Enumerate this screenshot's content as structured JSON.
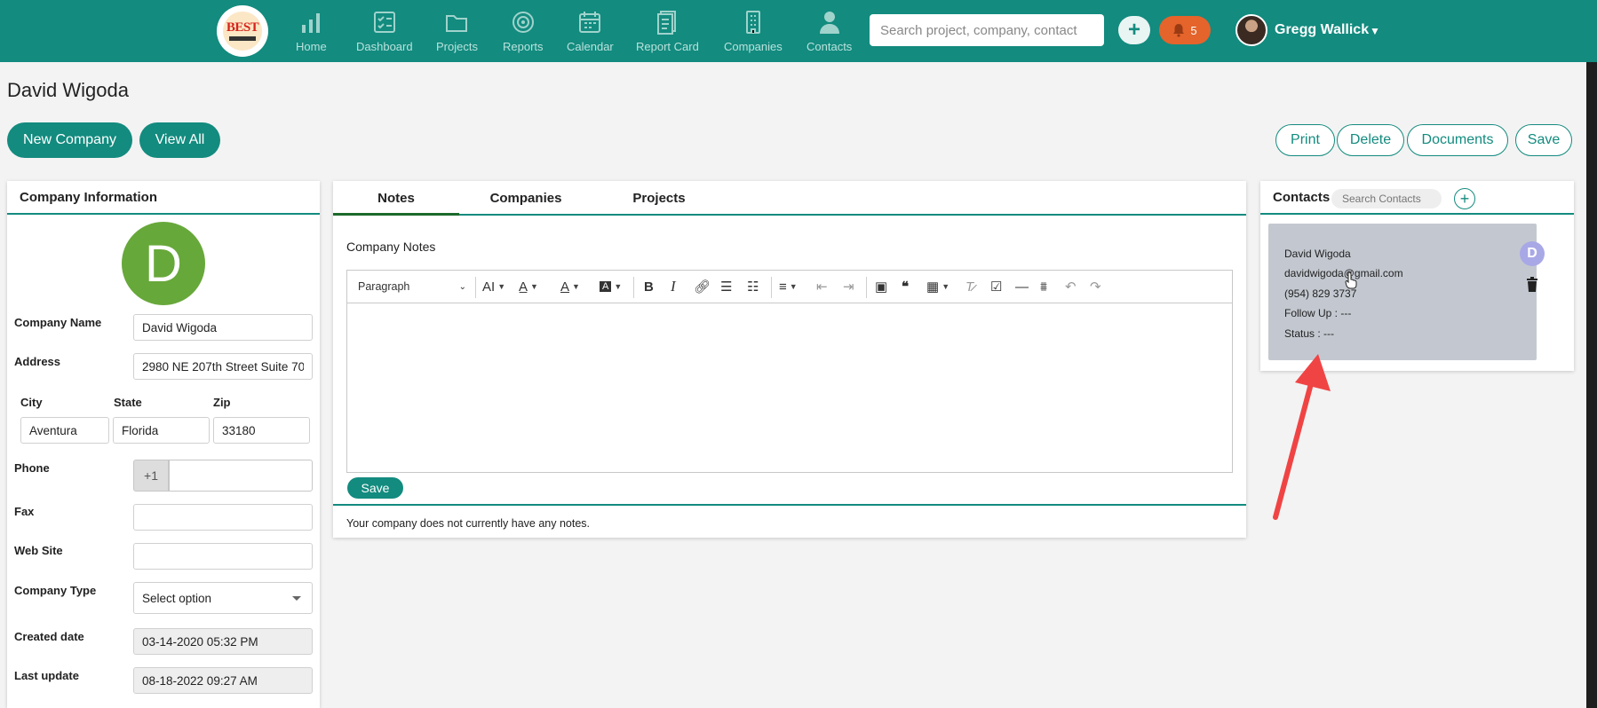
{
  "nav": {
    "items": [
      {
        "label": "Home",
        "icon": "bar-chart-icon"
      },
      {
        "label": "Dashboard",
        "icon": "dashboard-icon"
      },
      {
        "label": "Projects",
        "icon": "folder-icon"
      },
      {
        "label": "Reports",
        "icon": "target-icon"
      },
      {
        "label": "Calendar",
        "icon": "calendar-icon"
      },
      {
        "label": "Report Card",
        "icon": "report-card-icon"
      },
      {
        "label": "Companies",
        "icon": "building-icon"
      },
      {
        "label": "Contacts",
        "icon": "person-icon"
      }
    ],
    "search_placeholder": "Search project, company, contact",
    "notification_count": "5",
    "user_name": "Gregg Wallick",
    "logo_text": "BEST"
  },
  "page": {
    "title": "David Wigoda",
    "new_company_label": "New Company",
    "view_all_label": "View All",
    "print_label": "Print",
    "delete_label": "Delete",
    "documents_label": "Documents",
    "save_label": "Save"
  },
  "company_info": {
    "heading": "Company Information",
    "avatar_letter": "D",
    "company_name_label": "Company Name",
    "company_name": "David Wigoda",
    "address_label": "Address",
    "address": "2980 NE 207th Street Suite 70",
    "city_label": "City",
    "city": "Aventura",
    "state_label": "State",
    "state": "Florida",
    "zip_label": "Zip",
    "zip": "33180",
    "phone_label": "Phone",
    "phone_prefix": "+1",
    "phone": "",
    "fax_label": "Fax",
    "fax": "",
    "website_label": "Web Site",
    "website": "",
    "company_type_label": "Company Type",
    "company_type": "Select option",
    "created_label": "Created date",
    "created": "03-14-2020 05:32 PM",
    "updated_label": "Last update",
    "updated": "08-18-2022 09:27 AM"
  },
  "notes": {
    "tabs": [
      "Notes",
      "Companies",
      "Projects"
    ],
    "section_title": "Company Notes",
    "paragraph_label": "Paragraph",
    "save_label": "Save",
    "empty_message": "Your company does not currently have any notes."
  },
  "contacts": {
    "heading": "Contacts",
    "search_placeholder": "Search Contacts",
    "card": {
      "avatar_letter": "D",
      "name": "David Wigoda",
      "email": "davidwigoda@gmail.com",
      "phone": "(954) 829 3737",
      "follow_up": "Follow Up : ---",
      "status": "Status : ---"
    }
  },
  "colors": {
    "brand": "#138b7f",
    "notification": "#e4642b",
    "avatar_green": "#67a83a",
    "annotation_arrow": "#f04444"
  }
}
